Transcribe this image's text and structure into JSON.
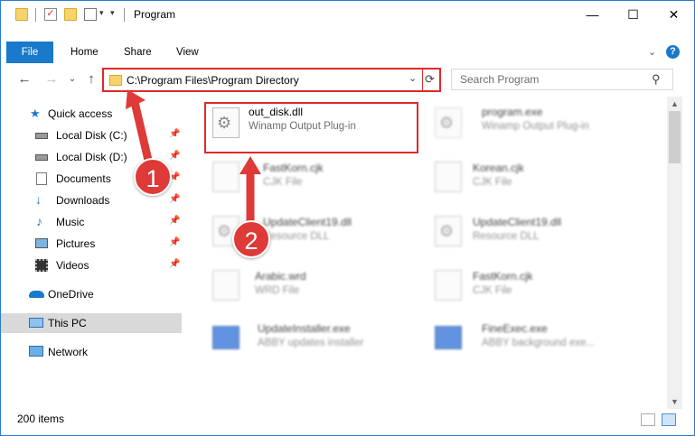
{
  "window": {
    "title": "Program",
    "minimize": "—",
    "maximize": "☐",
    "close": "✕"
  },
  "ribbon": {
    "tabs": [
      "File",
      "Home",
      "Share",
      "View"
    ],
    "collapse_glyph": "⌄",
    "help_glyph": "?"
  },
  "nav": {
    "back": "←",
    "forward": "→",
    "recent": "⌄",
    "up": "↑"
  },
  "address": {
    "path": "C:\\Program Files\\Program Directory",
    "dropdown": "⌄",
    "refresh": "⟳"
  },
  "search": {
    "placeholder": "Search Program",
    "icon": "⚲"
  },
  "sidebar": {
    "items": [
      {
        "label": "Quick access",
        "icon": "star-icon",
        "pinned": false
      },
      {
        "label": "Local Disk (C:)",
        "icon": "drive-icon",
        "pinned": true
      },
      {
        "label": "Local Disk (D:)",
        "icon": "drive-icon",
        "pinned": true
      },
      {
        "label": "Documents",
        "icon": "documents-icon",
        "pinned": true
      },
      {
        "label": "Downloads",
        "icon": "download-icon",
        "pinned": true
      },
      {
        "label": "Music",
        "icon": "music-icon",
        "pinned": true
      },
      {
        "label": "Pictures",
        "icon": "pictures-icon",
        "pinned": true
      },
      {
        "label": "Videos",
        "icon": "videos-icon",
        "pinned": true
      },
      {
        "label": "OneDrive",
        "icon": "cloud-icon",
        "pinned": false
      },
      {
        "label": "This PC",
        "icon": "computer-icon",
        "pinned": false,
        "selected": true
      },
      {
        "label": "Network",
        "icon": "network-icon",
        "pinned": false
      }
    ],
    "pin_glyph": "📌"
  },
  "files": [
    {
      "name": "out_disk.dll",
      "type": "Winamp Output Plug-in"
    },
    {
      "name": "program.exe",
      "type": "Winamp Output Plug-in"
    },
    {
      "name": "FastKorn.cjk",
      "type": "CJK File"
    },
    {
      "name": "Korean.cjk",
      "type": "CJK File"
    },
    {
      "name": "UpdateClient19.dll",
      "type": "Resource DLL"
    },
    {
      "name": "UpdateClient19.dll",
      "type": "Resource DLL"
    },
    {
      "name": "Arabic.wrd",
      "type": "WRD File"
    },
    {
      "name": "FastKorn.cjk",
      "type": "CJK File"
    },
    {
      "name": "UpdateInstaller.exe",
      "type": "ABBY updates installer"
    },
    {
      "name": "FineExec.exe",
      "type": "ABBY background exe..."
    }
  ],
  "callouts": [
    "1",
    "2"
  ],
  "status": {
    "item_count": "200 items"
  },
  "colors": {
    "accent": "#1979ca",
    "highlight": "#e0282a",
    "callout": "#de3a38"
  }
}
